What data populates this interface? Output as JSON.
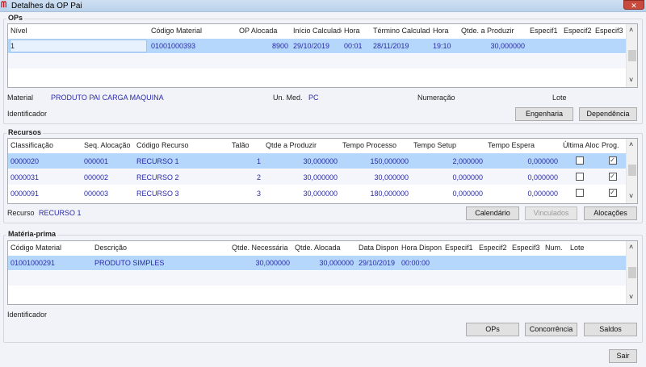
{
  "window": {
    "title": "Detalhes da OP Pai",
    "close": "✕",
    "logo_text": "SM"
  },
  "ops": {
    "label": "OPs",
    "columns": [
      "Nível",
      "Código Material",
      "OP Alocada",
      "Início Calculado",
      "Hora",
      "Término Calculado",
      "Hora",
      "Qtde. a Produzir",
      "Especif1",
      "Especif2",
      "Especif3"
    ],
    "rows": [
      [
        "1",
        "01001000393",
        "8900",
        "29/10/2019",
        "00:01",
        "28/11/2019",
        "19:10",
        "30,000000",
        "",
        "",
        ""
      ]
    ],
    "material_label": "Material",
    "material_value": "PRODUTO PAI CARGA MAQUINA",
    "unmed_label": "Un. Med.",
    "unmed_value": "PC",
    "numeracao_label": "Numeração",
    "lote_label": "Lote",
    "identificador_label": "Identificador",
    "buttons": [
      "Engenharia",
      "Dependência"
    ]
  },
  "recursos": {
    "label": "Recursos",
    "columns": [
      "Classificação",
      "Seq. Alocação",
      "Código Recurso",
      "Talão",
      "Qtde a Produzir",
      "Tempo Processo",
      "Tempo Setup",
      "Tempo Espera",
      "Última Aloc.",
      "Prog."
    ],
    "rows": [
      [
        "0000020",
        "000001",
        "RECURSO 1",
        "1",
        "30,000000",
        "150,000000",
        "2,000000",
        "0,000000",
        false,
        true
      ],
      [
        "0000031",
        "000002",
        "RECURSO 2",
        "2",
        "30,000000",
        "30,000000",
        "0,000000",
        "0,000000",
        false,
        true
      ],
      [
        "0000091",
        "000003",
        "RECURSO 3",
        "3",
        "30,000000",
        "180,000000",
        "0,000000",
        "0,000000",
        false,
        true
      ]
    ],
    "recurso_label": "Recurso",
    "recurso_value": "RECURSO 1",
    "buttons": [
      {
        "label": "Calendário",
        "enabled": true
      },
      {
        "label": "Vinculados",
        "enabled": false
      },
      {
        "label": "Alocações",
        "enabled": true
      }
    ]
  },
  "materia": {
    "label": "Matéria-prima",
    "columns": [
      "Código Material",
      "Descrição",
      "Qtde. Necessária",
      "Qtde. Alocada",
      "Data Dispon.",
      "Hora Dispon.",
      "Especif1",
      "Especif2",
      "Especif3",
      "Num.",
      "Lote"
    ],
    "rows": [
      [
        "01001000291",
        "PRODUTO SIMPLES",
        "30,000000",
        "30,000000",
        "29/10/2019",
        "00:00:00",
        "",
        "",
        "",
        "",
        ""
      ]
    ],
    "identificador_label": "Identificador",
    "buttons": [
      "OPs",
      "Concorrência",
      "Saldos"
    ]
  },
  "footer": {
    "sair": "Sair"
  },
  "colors": {
    "selection": "#b5d7fb",
    "value_text": "#2a2aa8"
  }
}
